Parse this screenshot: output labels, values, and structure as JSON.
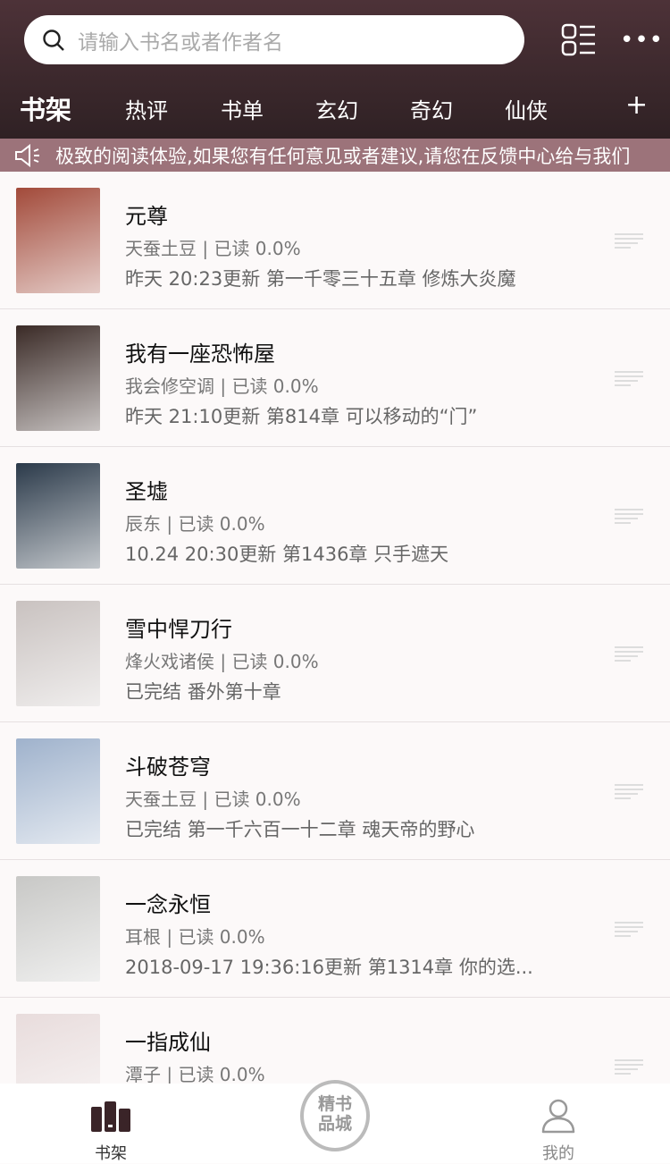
{
  "search": {
    "placeholder": "请输入书名或者作者名"
  },
  "tabs": [
    "书架",
    "热评",
    "书单",
    "玄幻",
    "奇幻",
    "仙侠"
  ],
  "tabs_add": "+",
  "notice": "极致的阅读体验,如果您有任何意见或者建议,请您在反馈中心给与我们",
  "books": [
    {
      "title": "元尊",
      "meta": "天蚕土豆 | 已读 0.0%",
      "update": "昨天 20:23更新 第一千零三十五章  修炼大炎魔",
      "color": "#a24a3a"
    },
    {
      "title": "我有一座恐怖屋",
      "meta": "我会修空调 | 已读 0.0%",
      "update": "昨天 21:10更新 第814章 可以移动的“门”",
      "color": "#3a2a26"
    },
    {
      "title": "圣墟",
      "meta": "辰东 | 已读 0.0%",
      "update": "10.24 20:30更新 第1436章 只手遮天",
      "color": "#2b3a4a"
    },
    {
      "title": "雪中悍刀行",
      "meta": "烽火戏诸侯 | 已读 0.0%",
      "update": "已完结 番外第十章",
      "color": "#c9c2c0"
    },
    {
      "title": "斗破苍穹",
      "meta": "天蚕土豆 | 已读 0.0%",
      "update": "已完结 第一千六百一十二章 魂天帝的野心",
      "color": "#9fb2cc"
    },
    {
      "title": "一念永恒",
      "meta": "耳根 | 已读 0.0%",
      "update": "2018-09-17 19:36:16更新 第1314章 你的选...",
      "color": "#c8c8c6"
    },
    {
      "title": "一指成仙",
      "meta": "潭子 | 已读 0.0%",
      "update": "",
      "color": "#e8dcdc"
    }
  ],
  "tabbar": {
    "shelf": "书架",
    "stamp": "精书品城",
    "mine": "我的"
  }
}
